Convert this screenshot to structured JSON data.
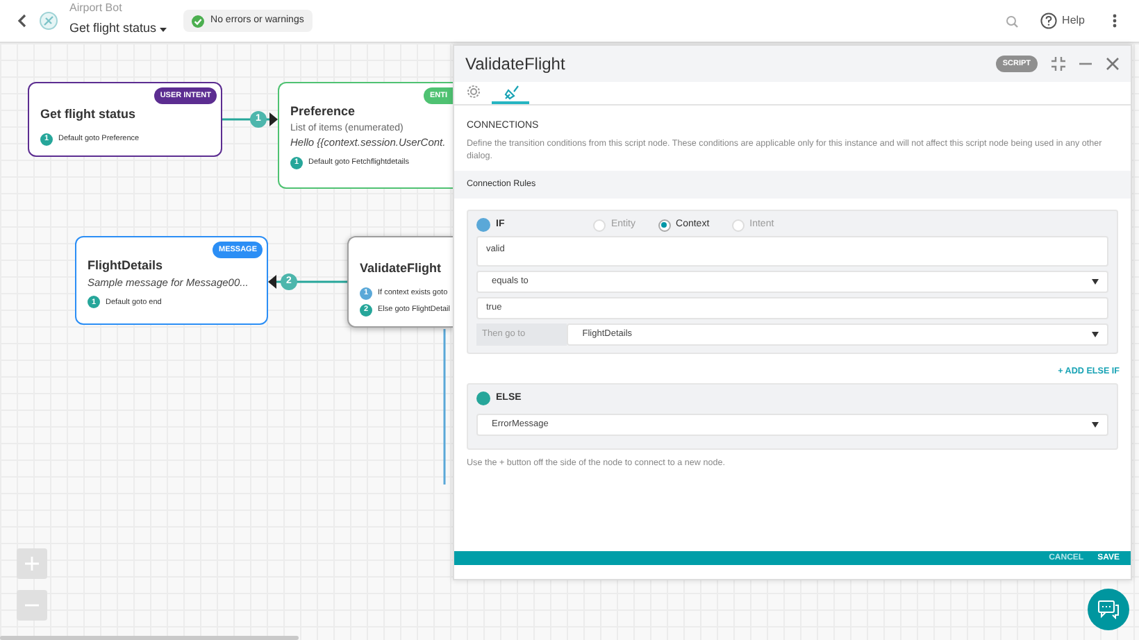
{
  "header": {
    "bot_name": "Airport Bot",
    "dialog": "Get flight status",
    "status": "No errors or warnings",
    "help": "Help"
  },
  "canvas": {
    "nodes": [
      {
        "kind": "intent",
        "title": "Get flight status",
        "badge": "USER INTENT",
        "color": "#5c2d91",
        "connections": [
          {
            "number": "1",
            "label": "Default goto Preference",
            "color": "#26a69a"
          }
        ]
      },
      {
        "kind": "entity",
        "title": "Preference",
        "badge": "ENTI",
        "color": "#4fc272",
        "subtitle": "List of items (enumerated)",
        "message": "Hello {{context.session.UserCont.",
        "connections": [
          {
            "number": "1",
            "label": "Default goto Fetchflightdetails",
            "color": "#26a69a"
          }
        ]
      },
      {
        "kind": "message",
        "title": "FlightDetails",
        "badge": "MESSAGE",
        "color": "#2b8ef5",
        "message": "Sample message for Message00...",
        "connections": [
          {
            "number": "1",
            "label": "Default goto end",
            "color": "#26a69a"
          }
        ]
      },
      {
        "kind": "script",
        "title": "ValidateFlight",
        "color": "#9e9e9e",
        "connections": [
          {
            "number": "1",
            "label": "If context exists goto",
            "color": "#5aa8d8"
          },
          {
            "number": "2",
            "label": "Else goto FlightDetail",
            "color": "#26a69a"
          }
        ]
      }
    ],
    "edges": [
      {
        "label": "1"
      },
      {
        "label": "2"
      }
    ]
  },
  "panel": {
    "title": "ValidateFlight",
    "badge": "SCRIPT",
    "tabs": [
      {
        "kind": "settings",
        "selected": false
      },
      {
        "kind": "connections",
        "selected": true
      }
    ],
    "section_title": "CONNECTIONS",
    "description": "Define the transition conditions from this script node. These conditions are applicable only for this instance and will not affect this script node being used in any other dialog.",
    "rules_heading": "Connection Rules",
    "if_rule": {
      "label": "IF",
      "color": "#5aa8d8",
      "options": [
        {
          "label": "Entity",
          "selected": false
        },
        {
          "label": "Context",
          "selected": true
        },
        {
          "label": "Intent",
          "selected": false
        }
      ],
      "variable": "valid",
      "operator": "equals to",
      "value": "true",
      "then_label": "Then go to",
      "target": "FlightDetails"
    },
    "add_else_if": "+ ADD ELSE IF",
    "else_rule": {
      "label": "ELSE",
      "color": "#26a69a",
      "target": "ErrorMessage"
    },
    "hint": "Use the + button off the side of the node to connect to a new node.",
    "footer": {
      "cancel": "CANCEL",
      "save": "SAVE"
    }
  }
}
